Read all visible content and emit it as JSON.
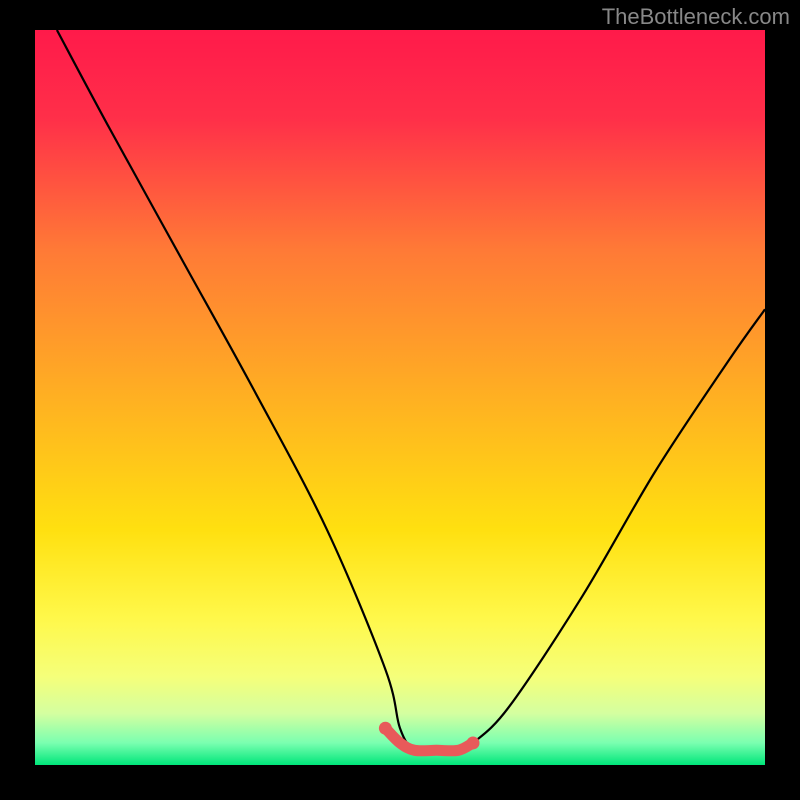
{
  "watermark": "TheBottleneck.com",
  "chart_data": {
    "type": "line",
    "title": "",
    "xlabel": "",
    "ylabel": "",
    "xlim": [
      0,
      100
    ],
    "ylim": [
      0,
      100
    ],
    "series": [
      {
        "name": "bottleneck-curve",
        "x": [
          3,
          10,
          20,
          30,
          40,
          48,
          50,
          52,
          55,
          58,
          60,
          65,
          75,
          85,
          95,
          100
        ],
        "y": [
          100,
          87,
          69,
          51,
          32,
          13,
          5,
          2,
          2,
          2,
          3,
          8,
          23,
          40,
          55,
          62
        ]
      },
      {
        "name": "highlight-band",
        "x": [
          48,
          50,
          52,
          55,
          58,
          60
        ],
        "y": [
          5,
          3,
          2,
          2,
          2,
          3
        ]
      }
    ],
    "gradient_stops": [
      {
        "offset": 0.0,
        "color": "#ff1a4a"
      },
      {
        "offset": 0.12,
        "color": "#ff2f49"
      },
      {
        "offset": 0.3,
        "color": "#ff7a36"
      },
      {
        "offset": 0.5,
        "color": "#ffb022"
      },
      {
        "offset": 0.68,
        "color": "#ffe010"
      },
      {
        "offset": 0.8,
        "color": "#fff84a"
      },
      {
        "offset": 0.88,
        "color": "#f5ff7a"
      },
      {
        "offset": 0.93,
        "color": "#d4ffa0"
      },
      {
        "offset": 0.97,
        "color": "#7affb0"
      },
      {
        "offset": 1.0,
        "color": "#00e67a"
      }
    ],
    "curve_color": "#000000",
    "highlight_color": "#e85a5a"
  }
}
